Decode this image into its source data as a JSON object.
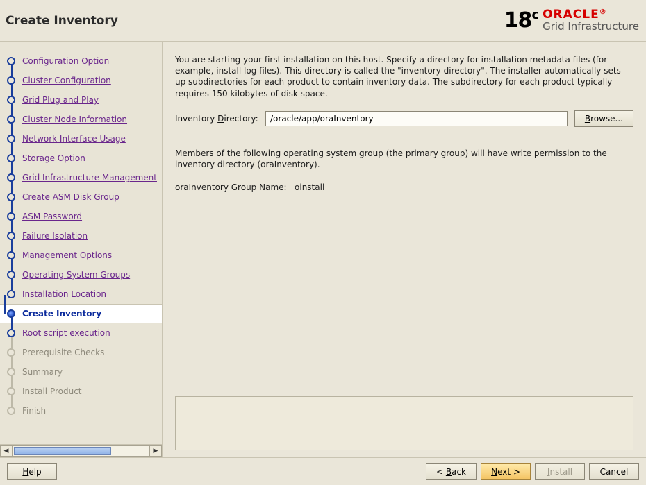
{
  "header": {
    "title": "Create Inventory",
    "version": "18",
    "version_suffix": "c",
    "brand": "ORACLE",
    "brand_reg": "®",
    "product": "Grid Infrastructure"
  },
  "sidebar": {
    "items": [
      {
        "label": "Configuration Option",
        "state": "done"
      },
      {
        "label": "Cluster Configuration",
        "state": "done"
      },
      {
        "label": "Grid Plug and Play",
        "state": "done"
      },
      {
        "label": "Cluster Node Information",
        "state": "done"
      },
      {
        "label": "Network Interface Usage",
        "state": "done"
      },
      {
        "label": "Storage Option",
        "state": "done"
      },
      {
        "label": "Grid Infrastructure Management",
        "state": "done"
      },
      {
        "label": "Create ASM Disk Group",
        "state": "done"
      },
      {
        "label": "ASM Password",
        "state": "done"
      },
      {
        "label": "Failure Isolation",
        "state": "done"
      },
      {
        "label": "Management Options",
        "state": "done"
      },
      {
        "label": "Operating System Groups",
        "state": "done"
      },
      {
        "label": "Installation Location",
        "state": "done"
      },
      {
        "label": "Create Inventory",
        "state": "current"
      },
      {
        "label": "Root script execution",
        "state": "next"
      },
      {
        "label": "Prerequisite Checks",
        "state": "future"
      },
      {
        "label": "Summary",
        "state": "future"
      },
      {
        "label": "Install Product",
        "state": "future"
      },
      {
        "label": "Finish",
        "state": "future"
      }
    ]
  },
  "main": {
    "intro": "You are starting your first installation on this host. Specify a directory for installation metadata files (for example, install log files). This directory is called the \"inventory directory\". The installer automatically sets up subdirectories for each product to contain inventory data. The subdirectory for each product typically requires 150 kilobytes of disk space.",
    "inventory_label_pre": "Inventory ",
    "inventory_label_mn": "D",
    "inventory_label_post": "irectory:",
    "inventory_value": "/oracle/app/oraInventory",
    "browse_mn": "B",
    "browse_rest": "rowse...",
    "perm_text": "Members of the following operating system group (the primary group) will have write permission to the inventory directory (oraInventory).",
    "group_label": "oraInventory Group Name:",
    "group_value": "oinstall"
  },
  "footer": {
    "help_mn": "H",
    "help_rest": "elp",
    "back_pre": "< ",
    "back_mn": "B",
    "back_rest": "ack",
    "next_mn": "N",
    "next_rest": "ext >",
    "install_mn": "I",
    "install_rest": "nstall",
    "cancel": "Cancel"
  }
}
